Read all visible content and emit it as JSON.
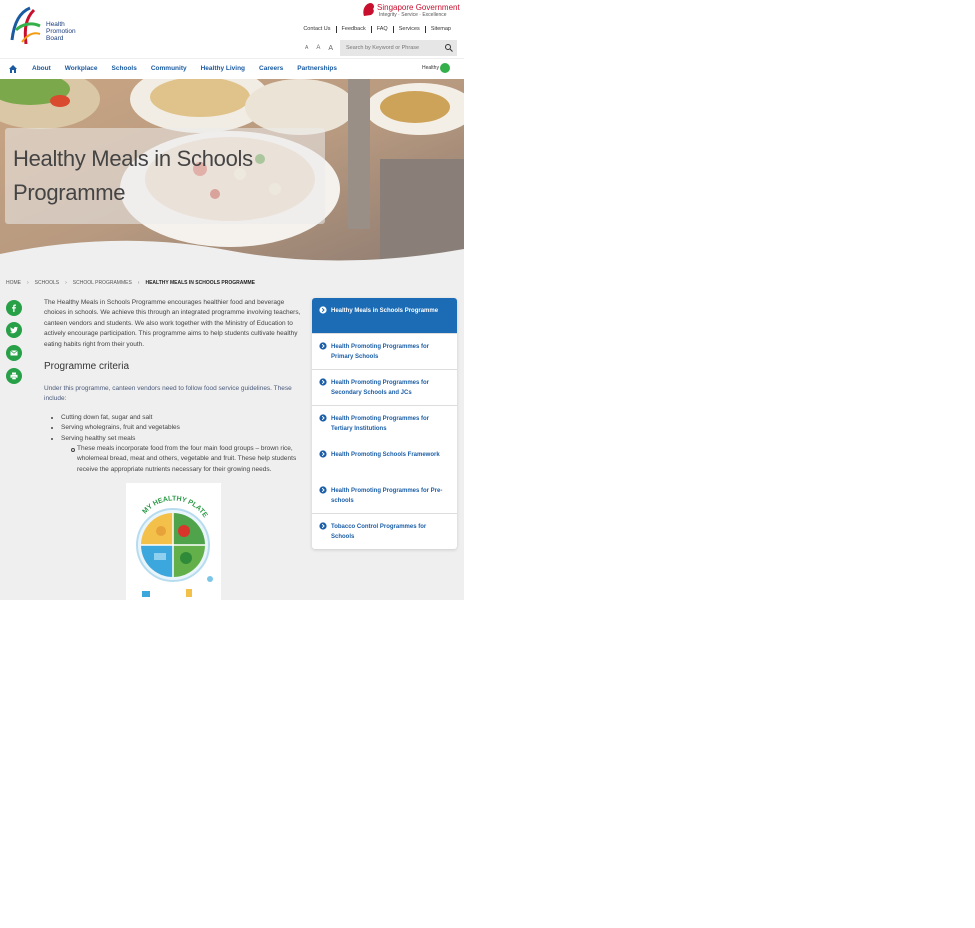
{
  "header": {
    "logo_lines": [
      "Health",
      "Promotion",
      "Board"
    ],
    "gov_title": "Singapore Government",
    "gov_tagline": "Integrity · Service · Excellence",
    "top_links": [
      "Contact Us",
      "Feedback",
      "FAQ",
      "Services",
      "Sitemap"
    ],
    "font_sizes": [
      "A",
      "A",
      "A"
    ],
    "search_placeholder": "Search by Keyword or Phrase"
  },
  "nav": {
    "items": [
      "About",
      "Workplace",
      "Schools",
      "Community",
      "Healthy Living",
      "Careers",
      "Partnerships"
    ],
    "badge_text": "Healthy"
  },
  "hero": {
    "title": "Healthy Meals in Schools Programme"
  },
  "breadcrumb": {
    "items": [
      "HOME",
      "SCHOOLS",
      "SCHOOL PROGRAMMES",
      "HEALTHY MEALS IN SCHOOLS PROGRAMME"
    ],
    "separator": "›"
  },
  "social": [
    "facebook-icon",
    "twitter-icon",
    "email-icon",
    "print-icon"
  ],
  "content": {
    "intro": "The Healthy Meals in Schools Programme encourages healthier food and beverage choices in schools. We achieve this through an integrated programme involving teachers, canteen vendors and students. We also work together with the Ministry of Education to actively encourage participation. This programme aims to help students cultivate healthy eating habits right from their youth.",
    "criteria_heading": "Programme criteria",
    "criteria_intro": "Under this programme, canteen vendors need to follow food service guidelines. These include:",
    "criteria_items": [
      "Cutting down fat, sugar and salt",
      "Serving wholegrains, fruit and vegetables",
      "Serving healthy set meals"
    ],
    "sub_item": "These meals incorporate food from the four main food groups – brown rice, wholemeal bread, meat and others, vegetable and fruit. These help students receive the appropriate nutrients necessary for their growing needs.",
    "plate_title": "MY HEALTHY PLATE"
  },
  "sidebar": {
    "items": [
      {
        "label": "Healthy Meals in Schools Programme",
        "active": true
      },
      {
        "label": "Health Promoting Programmes for Primary Schools",
        "active": false
      },
      {
        "label": "Health Promoting Programmes for Secondary Schools and JCs",
        "active": false
      },
      {
        "label": "Health Promoting Programmes for Tertiary Institutions",
        "active": false
      },
      {
        "label": "Health Promoting Schools Framework",
        "active": false
      },
      {
        "label": "Health Promoting Programmes for Pre-schools",
        "active": false
      },
      {
        "label": "Tobacco Control Programmes for Schools",
        "active": false
      }
    ]
  },
  "colors": {
    "nav_text": "#1a5aa0",
    "sidebar_active": "#1c6bb5",
    "social_green": "#27a047",
    "gov_red": "#c8102e"
  }
}
